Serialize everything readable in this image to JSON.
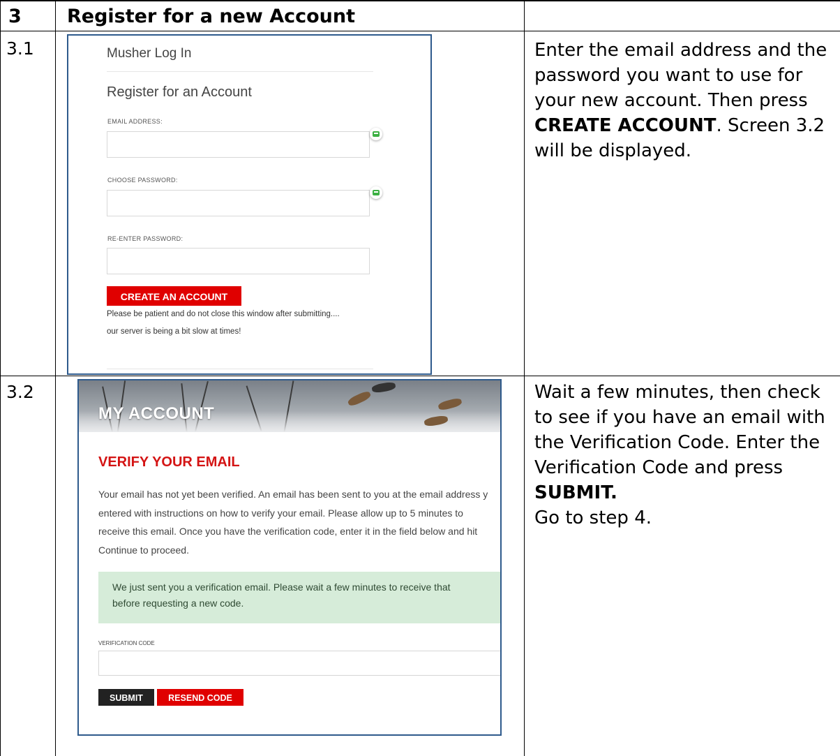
{
  "table": {
    "header": {
      "number": "3",
      "title": "Register for a new Account"
    },
    "rows": [
      {
        "step": "3.1",
        "instruction": {
          "text1": "Enter the email address and the password you want to use for your new account. Then press ",
          "bold": "CREATE ACCOUNT",
          "text2": ". Screen 3.2 will be displayed."
        }
      },
      {
        "step": "3.2",
        "instruction": {
          "text1": "Wait a few minutes, then check to see if you have an email with the Verification Code.   Enter the Verification Code and press ",
          "bold": "SUBMIT.",
          "text2": "Go to step 4."
        }
      }
    ]
  },
  "register_screen": {
    "title": "Musher Log In",
    "subtitle": "Register for an Account",
    "email_label": "EMAIL ADDRESS:",
    "password_label": "CHOOSE PASSWORD:",
    "reenter_label": "RE-ENTER PASSWORD:",
    "email_value": "",
    "password_value": "",
    "reenter_value": "",
    "create_button": "CREATE AN ACCOUNT",
    "note_line1": "Please be patient and do not close this window after submitting....",
    "note_line2": "our server is being a bit slow at times!",
    "colors": {
      "button": "#e00000",
      "border": "#2e5a8c"
    }
  },
  "verify_screen": {
    "banner_title": "MY ACCOUNT",
    "heading": "VERIFY YOUR EMAIL",
    "paragraph_lines": [
      "Your email has not yet been verified. An email has been sent to you at the email address y",
      "entered with instructions on how to verify your email. Please allow up to 5 minutes to",
      "receive this email. Once you have the verification code, enter it in the field below and hit",
      "Continue to proceed."
    ],
    "alert_line1": "We just sent you a verification email. Please wait a few minutes to receive that",
    "alert_line2": "before requesting a new code.",
    "alert_close": "×",
    "code_label": "VERIFICATION CODE",
    "code_value": "",
    "submit_button": "SUBMIT",
    "resend_button": "RESEND CODE",
    "colors": {
      "heading": "#d41414",
      "alert_bg": "#d6ecd9",
      "submit": "#222222",
      "resend": "#e00000"
    }
  }
}
